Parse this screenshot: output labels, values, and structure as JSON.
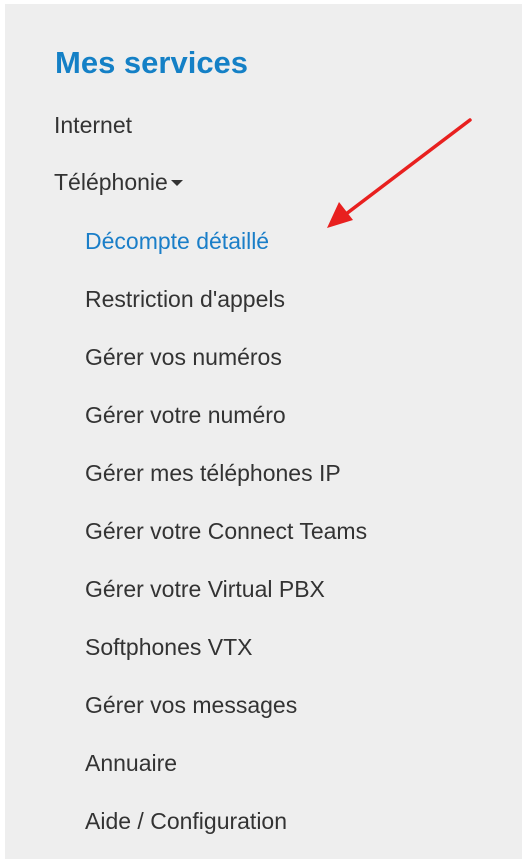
{
  "sidebar": {
    "title": "Mes services",
    "items": [
      {
        "label": "Internet"
      },
      {
        "label": "Téléphonie"
      }
    ],
    "submenu": [
      {
        "label": "Décompte détaillé",
        "active": true
      },
      {
        "label": "Restriction d'appels"
      },
      {
        "label": "Gérer vos numéros"
      },
      {
        "label": "Gérer votre numéro"
      },
      {
        "label": "Gérer mes téléphones IP"
      },
      {
        "label": "Gérer votre Connect Teams"
      },
      {
        "label": "Gérer votre Virtual PBX"
      },
      {
        "label": "Softphones VTX"
      },
      {
        "label": "Gérer vos messages"
      },
      {
        "label": "Annuaire"
      },
      {
        "label": "Aide / Configuration"
      }
    ]
  },
  "colors": {
    "title": "#1480c6",
    "active_link": "#1a7ec8",
    "text": "#333333",
    "panel_background": "#eeeeee",
    "annotation_arrow": "#e8201f"
  },
  "icons": {
    "dropdown": "caret-down-icon",
    "annotation": "red-arrow-icon"
  }
}
